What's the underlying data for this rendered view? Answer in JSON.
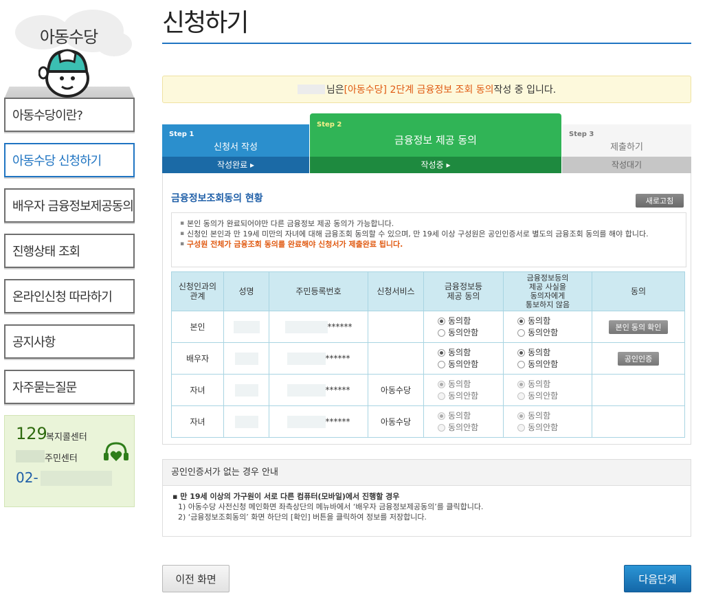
{
  "sidebar": {
    "brand_title": "아동수당",
    "menu": [
      {
        "label": "아동수당이란?",
        "active": false
      },
      {
        "label": "아동수당 신청하기",
        "active": true
      },
      {
        "label": "배우자 금융정보제공동의",
        "active": false
      },
      {
        "label": "진행상태 조회",
        "active": false
      },
      {
        "label": "온라인신청 따라하기",
        "active": false
      },
      {
        "label": "공지사항",
        "active": false
      },
      {
        "label": "자주묻는질문",
        "active": false
      }
    ],
    "callcenter": {
      "number_129": "129",
      "label_129": "복지콜센터",
      "center_label": "주민센터",
      "phone_prefix": "02-"
    }
  },
  "page": {
    "title": "신청하기"
  },
  "notice": {
    "after_name": "님은 ",
    "highlight": "[아동수당] 2단계 금융정보 조회 동의",
    "suffix": " 작성 중 입니다."
  },
  "steps": [
    {
      "no": "Step 1",
      "label": "신청서 작성",
      "status": "작성완료 ▸"
    },
    {
      "no": "Step 2",
      "label": "금융정보 제공 동의",
      "status": "작성중 ▸"
    },
    {
      "no": "Step 3",
      "label": "제출하기",
      "status": "작성대기"
    }
  ],
  "consent_panel": {
    "title": "금융정보조회동의 현황",
    "refresh_label": "새로고침",
    "guide": [
      "본인 동의가 완료되어야만 다른 금융정보 제공 동의가 가능합니다.",
      "신청인 본인과 만 19세 미만의 자녀에 대해 금융조회 동의할 수 있으며, 만 19세 이상 구성원은 공인인증서로 별도의 금융조회 동의를 해야 합니다.",
      "구성원 전체가 금융조회 동의를 완료해야 신청서가 제출완료 됩니다."
    ],
    "columns": [
      "신청인과의\n관계",
      "성명",
      "주민등록번호",
      "신청서비스",
      "금융정보등\n제공 동의",
      "금융정보등의\n제공 사실을\n동의자에게\n통보하지 않음",
      "동의"
    ],
    "rows": [
      {
        "relation": "본인",
        "rrn_mask": "******",
        "service": "",
        "button": "본인 동의 확인"
      },
      {
        "relation": "배우자",
        "rrn_mask": "******",
        "service": "",
        "button": "공인인증"
      },
      {
        "relation": "자녀",
        "rrn_mask": "******",
        "service": "아동수당",
        "button": ""
      },
      {
        "relation": "자녀",
        "rrn_mask": "******",
        "service": "아동수당",
        "button": ""
      }
    ],
    "agree_label": "동의함",
    "disagree_label": "동의안함"
  },
  "cert_guide": {
    "title": "공인인증서가 없는 경우 안내",
    "lead": "▪ 만 19세 이상의 가구원이 서로 다른 컴퓨터(모바일)에서 진행할 경우",
    "steps": [
      "1) 아동수당 사전신청 메인화면 좌측상단의 메뉴바에서 ‘배우자 금융정보제공동의’를 클릭합니다.",
      "2) ‘금융정보조회동의’ 화면 하단의 [확인] 버튼을 클릭하여 정보를 저장합니다."
    ]
  },
  "buttons": {
    "prev": "이전 화면",
    "next": "다음단계"
  },
  "colors": {
    "accent_blue": "#1f74c2",
    "step_green": "#30b456",
    "highlight_orange": "#e05a12"
  }
}
